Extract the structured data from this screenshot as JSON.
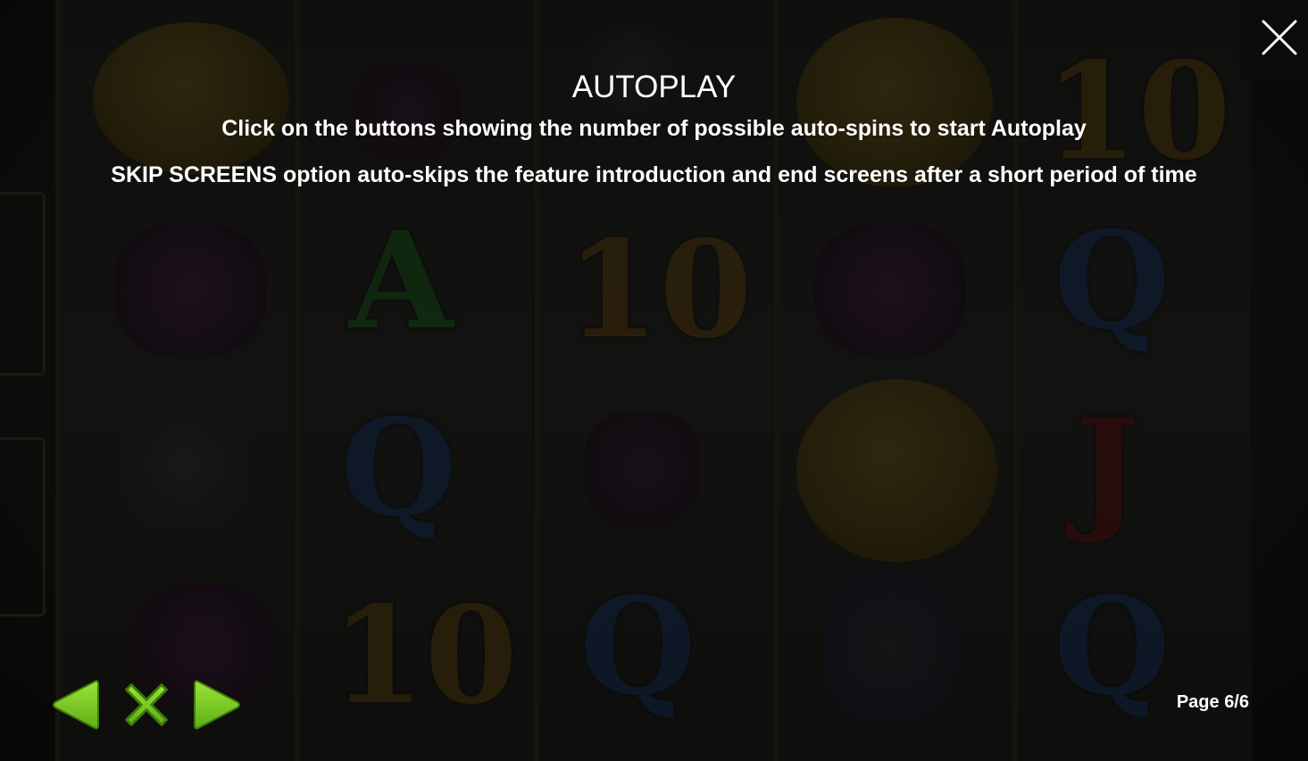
{
  "window": {
    "close_icon": "close-icon"
  },
  "help": {
    "title": "AUTOPLAY",
    "lines": [
      "Click on the buttons showing the number of possible auto-spins to start Autoplay",
      "SKIP SCREENS option auto-skips the feature introduction and end screens after a short period of time"
    ]
  },
  "navigation": {
    "prev_icon": "arrow-left-icon",
    "close_icon": "x-close-icon",
    "next_icon": "arrow-right-icon",
    "accent_color": "#7ed321"
  },
  "pagination": {
    "label": "Page 6/6"
  },
  "background": {
    "reel_symbols": [
      [
        "coin",
        "leprechaun",
        "leprechaun-hat",
        "leprechaun"
      ],
      [
        "pot",
        "A",
        "Q",
        "10"
      ],
      [
        "leprechaun-hat",
        "10",
        "pipe",
        "Q"
      ],
      [
        "coin",
        "leprechaun",
        "coin",
        "leprechaun-hat"
      ],
      [
        "10",
        "Q",
        "J",
        "Q"
      ]
    ]
  }
}
